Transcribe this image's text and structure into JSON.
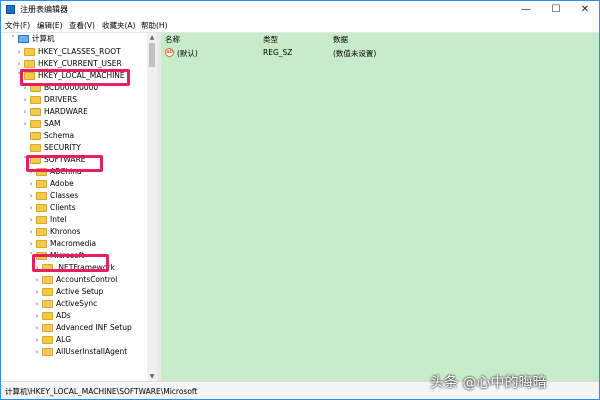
{
  "window": {
    "title": "注册表编辑器",
    "minimize": "—",
    "maximize": "☐",
    "close": "✕"
  },
  "menu": [
    "文件(F)",
    "编辑(E)",
    "查看(V)",
    "收藏夹(A)",
    "帮助(H)"
  ],
  "tree": {
    "root": "计算机",
    "items": [
      {
        "label": "HKEY_CLASSES_ROOT",
        "expander": "›"
      },
      {
        "label": "HKEY_CURRENT_USER",
        "expander": "›"
      },
      {
        "label": "HKEY_LOCAL_MACHINE",
        "expander": "˅"
      },
      {
        "label": "BCD00000000",
        "expander": "›"
      },
      {
        "label": "DRIVERS",
        "expander": "›"
      },
      {
        "label": "HARDWARE",
        "expander": "›"
      },
      {
        "label": "SAM",
        "expander": "›"
      },
      {
        "label": "Schema",
        "expander": ""
      },
      {
        "label": "SECURITY",
        "expander": ""
      },
      {
        "label": "SOFTWARE",
        "expander": "˅"
      },
      {
        "label": "ABChina",
        "expander": "›"
      },
      {
        "label": "Adobe",
        "expander": "›"
      },
      {
        "label": "Classes",
        "expander": "›"
      },
      {
        "label": "Clients",
        "expander": "›"
      },
      {
        "label": "Intel",
        "expander": "›"
      },
      {
        "label": "Khronos",
        "expander": "›"
      },
      {
        "label": "Macromedia",
        "expander": "›"
      },
      {
        "label": "Microsoft",
        "expander": "˅"
      },
      {
        "label": ".NETFramework",
        "expander": "›"
      },
      {
        "label": "AccountsControl",
        "expander": "›"
      },
      {
        "label": "Active Setup",
        "expander": "›"
      },
      {
        "label": "ActiveSync",
        "expander": "›"
      },
      {
        "label": "ADs",
        "expander": "›"
      },
      {
        "label": "Advanced INF Setup",
        "expander": "›"
      },
      {
        "label": "ALG",
        "expander": "›"
      },
      {
        "label": "AllUserInstallAgent",
        "expander": "›"
      }
    ]
  },
  "list": {
    "columns": [
      "名称",
      "类型",
      "数据"
    ],
    "rows": [
      {
        "name": "(默认)",
        "type": "REG_SZ",
        "data": "(数值未设置)",
        "icon": "ab"
      }
    ]
  },
  "status": "计算机\\HKEY_LOCAL_MACHINE\\SOFTWARE\\Microsoft",
  "watermark": "头条 @心中的晦暗",
  "colors": {
    "highlight": "#e61e62",
    "list_bg": "#c8ecca",
    "folder": "#f2c94c"
  }
}
